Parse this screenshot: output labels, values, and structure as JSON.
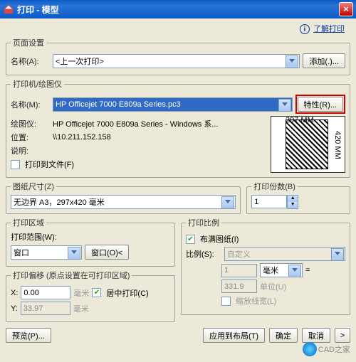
{
  "titlebar": {
    "title": "打印 - 模型",
    "close": "×"
  },
  "help": {
    "info_icon": "i",
    "link": "了解打印"
  },
  "page_setup": {
    "legend": "页面设置",
    "name_label": "名称(A):",
    "name_value": "<上一次打印>",
    "add_button": "添加(.)..."
  },
  "printer": {
    "legend": "打印机/绘图仪",
    "name_label": "名称(M):",
    "name_value": "HP Officejet 7000 E809a Series.pc3",
    "props_button": "特性(R)...",
    "plotter_label": "绘图仪:",
    "plotter_value": "HP Officejet 7000 E809a Series - Windows 系...",
    "location_label": "位置:",
    "location_value": "\\\\10.211.152.158",
    "desc_label": "说明:",
    "to_file_label": "打印到文件(F)",
    "preview_top": "297 MM",
    "preview_side": "420 MM"
  },
  "paper": {
    "legend": "图纸尺寸(Z)",
    "value": "无边界 A3，297x420 毫米"
  },
  "copies": {
    "legend": "打印份数(B)",
    "value": "1"
  },
  "area": {
    "legend": "打印区域",
    "range_label": "打印范围(W):",
    "range_value": "窗口",
    "window_button": "窗口(O)<"
  },
  "scale": {
    "legend": "打印比例",
    "fit_label": "布满图纸(I)",
    "scale_label": "比例(S):",
    "scale_value": "自定义",
    "num1": "1",
    "unit1": "毫米",
    "equals": "=",
    "num2": "331.9",
    "unit2": "单位(U)",
    "scale_lw": "缩放线宽(L)"
  },
  "offset": {
    "legend": "打印偏移 (原点设置在可打印区域)",
    "x_label": "X:",
    "x_value": "0.00",
    "x_unit": "毫米",
    "y_label": "Y:",
    "y_value": "33.97",
    "y_unit": "毫米",
    "center_label": "居中打印(C)"
  },
  "buttons": {
    "preview": "预览(P)...",
    "apply": "应用到布局(T)",
    "ok": "确定",
    "cancel": "取消",
    "expand": ">"
  },
  "watermark": "CAD之家"
}
